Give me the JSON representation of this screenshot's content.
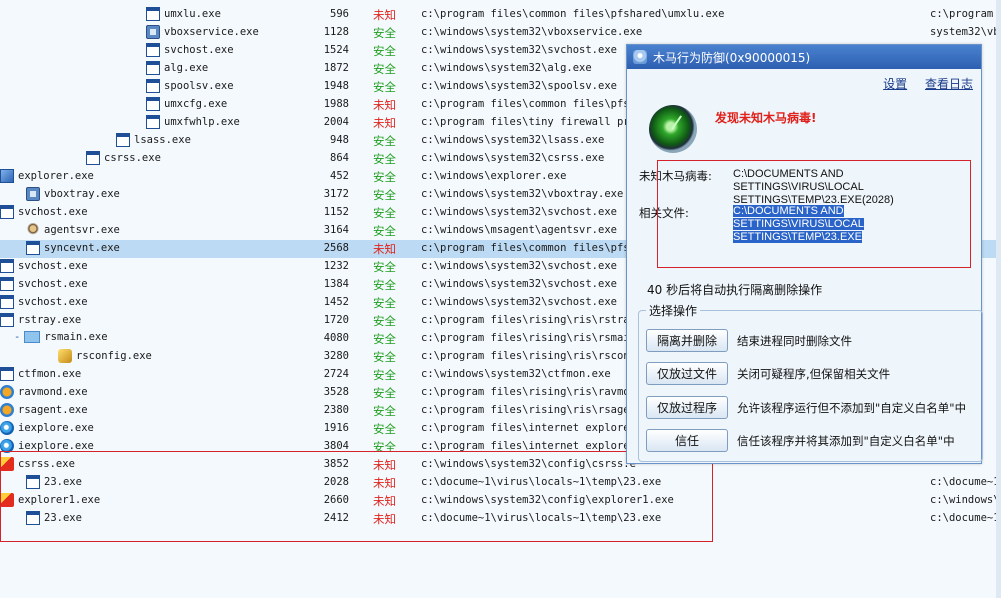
{
  "process_rows": [
    {
      "indent": 146,
      "icon": "win",
      "name": "umxlu.exe",
      "pid": "596",
      "status": "未知",
      "path": "c:\\program files\\common files\\pfshared\\umxlu.exe",
      "path2": "c:\\program f"
    },
    {
      "indent": 146,
      "icon": "vbox",
      "name": "vboxservice.exe",
      "pid": "1128",
      "status": "安全",
      "path": "c:\\windows\\system32\\vboxservice.exe",
      "path2": "system32\\vbo"
    },
    {
      "indent": 146,
      "icon": "win",
      "name": "svchost.exe",
      "pid": "1524",
      "status": "安全",
      "path": "c:\\windows\\system32\\svchost.exe",
      "path2": ""
    },
    {
      "indent": 146,
      "icon": "win",
      "name": "alg.exe",
      "pid": "1872",
      "status": "安全",
      "path": "c:\\windows\\system32\\alg.exe",
      "path2": ""
    },
    {
      "indent": 146,
      "icon": "win",
      "name": "spoolsv.exe",
      "pid": "1948",
      "status": "安全",
      "path": "c:\\windows\\system32\\spoolsv.exe",
      "path2": ""
    },
    {
      "indent": 146,
      "icon": "win",
      "name": "umxcfg.exe",
      "pid": "1988",
      "status": "未知",
      "path": "c:\\program files\\common files\\pfsh",
      "path2": ""
    },
    {
      "indent": 146,
      "icon": "win",
      "name": "umxfwhlp.exe",
      "pid": "2004",
      "status": "未知",
      "path": "c:\\program files\\tiny firewall pro",
      "path2": ""
    },
    {
      "indent": 116,
      "icon": "win",
      "name": "lsass.exe",
      "pid": "948",
      "status": "安全",
      "path": "c:\\windows\\system32\\lsass.exe",
      "path2": ""
    },
    {
      "indent": 86,
      "icon": "win",
      "name": "csrss.exe",
      "pid": "864",
      "status": "安全",
      "path": "c:\\windows\\system32\\csrss.exe",
      "path2": ""
    },
    {
      "indent": 0,
      "icon": "exp",
      "name": "explorer.exe",
      "pid": "452",
      "status": "安全",
      "path": "c:\\windows\\explorer.exe",
      "path2": ""
    },
    {
      "indent": 26,
      "icon": "vbox",
      "name": "vboxtray.exe",
      "pid": "3172",
      "status": "安全",
      "path": "c:\\windows\\system32\\vboxtray.exe",
      "path2": ""
    },
    {
      "indent": 0,
      "icon": "win",
      "name": "svchost.exe",
      "pid": "1152",
      "status": "安全",
      "path": "c:\\windows\\system32\\svchost.exe",
      "path2": ""
    },
    {
      "indent": 26,
      "icon": "agent",
      "name": "agentsvr.exe",
      "pid": "3164",
      "status": "安全",
      "path": "c:\\windows\\msagent\\agentsvr.exe",
      "path2": ""
    },
    {
      "indent": 26,
      "icon": "win",
      "name": "syncevnt.exe",
      "pid": "2568",
      "status": "未知",
      "path": "c:\\program files\\common files\\pfsh",
      "path2": "",
      "selected": true
    },
    {
      "indent": 0,
      "icon": "win",
      "name": "svchost.exe",
      "pid": "1232",
      "status": "安全",
      "path": "c:\\windows\\system32\\svchost.exe",
      "path2": ""
    },
    {
      "indent": 0,
      "icon": "win",
      "name": "svchost.exe",
      "pid": "1384",
      "status": "安全",
      "path": "c:\\windows\\system32\\svchost.exe",
      "path2": ""
    },
    {
      "indent": 0,
      "icon": "win",
      "name": "svchost.exe",
      "pid": "1452",
      "status": "安全",
      "path": "c:\\windows\\system32\\svchost.exe",
      "path2": ""
    },
    {
      "indent": 0,
      "icon": "win",
      "name": "rstray.exe",
      "pid": "1720",
      "status": "安全",
      "path": "c:\\program files\\rising\\ris\\rstray",
      "path2": ""
    },
    {
      "indent": 14,
      "icon": "rmain",
      "name": "rsmain.exe",
      "pid": "4080",
      "status": "安全",
      "path": "c:\\program files\\rising\\ris\\rsmain",
      "path2": "",
      "dash": "-"
    },
    {
      "indent": 58,
      "icon": "cfg",
      "name": "rsconfig.exe",
      "pid": "3280",
      "status": "安全",
      "path": "c:\\program files\\rising\\ris\\rsconf",
      "path2": ""
    },
    {
      "indent": 0,
      "icon": "win",
      "name": "ctfmon.exe",
      "pid": "2724",
      "status": "安全",
      "path": "c:\\windows\\system32\\ctfmon.exe",
      "path2": ""
    },
    {
      "indent": 0,
      "icon": "rs",
      "name": "ravmond.exe",
      "pid": "3528",
      "status": "安全",
      "path": "c:\\program files\\rising\\ris\\ravmon",
      "path2": ""
    },
    {
      "indent": 0,
      "icon": "rs",
      "name": "rsagent.exe",
      "pid": "2380",
      "status": "安全",
      "path": "c:\\program files\\rising\\ris\\rsagen",
      "path2": ""
    },
    {
      "indent": 0,
      "icon": "ie",
      "name": "iexplore.exe",
      "pid": "1916",
      "status": "安全",
      "path": "c:\\program files\\internet explorer",
      "path2": ""
    },
    {
      "indent": 0,
      "icon": "ie",
      "name": "iexplore.exe",
      "pid": "3804",
      "status": "安全",
      "path": "c:\\program files\\internet explorer",
      "path2": ""
    },
    {
      "indent": 0,
      "icon": "red",
      "name": "csrss.exe",
      "pid": "3852",
      "status": "未知",
      "path": "c:\\windows\\system32\\config\\csrss.e",
      "path2": ""
    },
    {
      "indent": 26,
      "icon": "win",
      "name": "23.exe",
      "pid": "2028",
      "status": "未知",
      "path": "c:\\docume~1\\virus\\locals~1\\temp\\23.exe",
      "path2": "c:\\docume~1\\"
    },
    {
      "indent": 0,
      "icon": "red",
      "name": "explorer1.exe",
      "pid": "2660",
      "status": "未知",
      "path": "c:\\windows\\system32\\config\\explorer1.exe",
      "path2": "c:\\windows\\s"
    },
    {
      "indent": 26,
      "icon": "win",
      "name": "23.exe",
      "pid": "2412",
      "status": "未知",
      "path": "c:\\docume~1\\virus\\locals~1\\temp\\23.exe",
      "path2": "c:\\docume~1\\"
    }
  ],
  "dialog": {
    "title": "木马行为防御(0x90000015)",
    "settings_link": "设置",
    "log_link": "查看日志",
    "warning": "发现未知木马病毒!",
    "virus_label": "未知木马病毒:",
    "virus_value": "C:\\DOCUMENTS AND SETTINGS\\VIRUS\\LOCAL SETTINGS\\TEMP\\23.EXE(2028)",
    "file_label": "相关文件:",
    "file_value": "C:\\DOCUMENTS AND SETTINGS\\VIRUS\\LOCAL SETTINGS\\TEMP\\23.EXE",
    "countdown": "40 秒后将自动执行隔离删除操作",
    "group_title": "选择操作",
    "options": [
      {
        "label": "隔离并删除",
        "desc": "结束进程同时删除文件"
      },
      {
        "label": "仅放过文件",
        "desc": "关闭可疑程序,但保留相关文件"
      },
      {
        "label": "仅放过程序",
        "desc": "允许该程序运行但不添加到\"自定义白名单\"中"
      },
      {
        "label": "信任",
        "desc": "信任该程序并将其添加到\"自定义白名单\"中"
      }
    ]
  },
  "colors": {
    "safe": "#1f9e1f",
    "unknown": "#e0231c",
    "selection": "#bcdaf3",
    "title_bar": "#2d5fb1"
  }
}
